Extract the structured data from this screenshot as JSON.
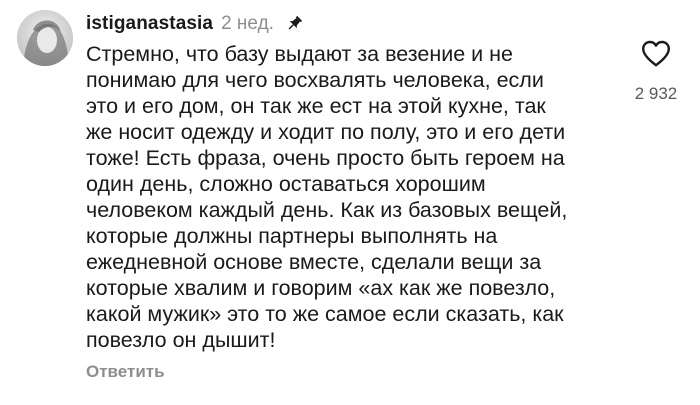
{
  "comment": {
    "username": "istiganastasia",
    "time": "2 нед.",
    "pinned_icon": "pin-icon",
    "text_lines": [
      "Стремно, что базу выдают за везение и не",
      "понимаю для чего восхвалять человека, если",
      "это и его дом, он так же ест на этой кухне, так",
      "же носит одежду и ходит по полу, это и его дети",
      "тоже! Есть фраза, очень просто быть героем на",
      "один день, сложно оставаться хорошим",
      "человеком каждый день. Как из базовых вещей,",
      "которые должны партнеры выполнять на",
      "ежедневной основе вместе, сделали вещи за",
      "которые хвалим и говорим «ах как же повезло,",
      "какой мужик» это то же самое если сказать, как",
      "повезло он дышит!"
    ],
    "reply_label": "Ответить",
    "like_icon": "heart-icon",
    "like_count": "2 932"
  },
  "colors": {
    "text": "#1a1a1a",
    "muted": "#8e8e8e",
    "count": "#595959"
  }
}
